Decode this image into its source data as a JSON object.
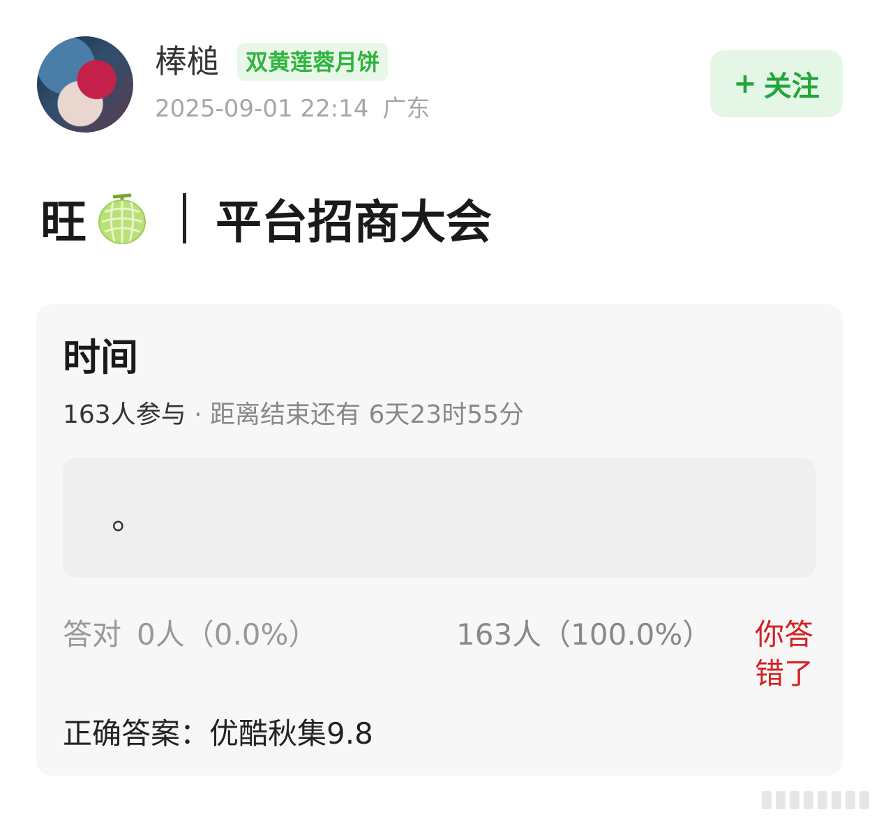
{
  "author": {
    "name": "棒槌",
    "badge": "双黄莲蓉月饼",
    "datetime": "2025-09-01 22:14",
    "location": "广东",
    "avatar_icon": "avatar-image"
  },
  "follow_button": {
    "plus": "+",
    "label": "关注",
    "color": "#22a53a"
  },
  "post": {
    "title_prefix": "旺",
    "emoji_icon": "melon-icon",
    "title": "平台招商大会"
  },
  "poll": {
    "title": "时间",
    "participants": "163人参与",
    "remaining": "· 距离结束还有 6天23时55分",
    "option_text": "。",
    "correct_label": "答对",
    "correct_value": "0人（0.0%）",
    "other_value": "163人（100.0%）",
    "wrong_line1": "你答",
    "wrong_line2": "错了",
    "answer": "正确答案：优酷秋集9.8",
    "accent_red": "#d42121"
  }
}
